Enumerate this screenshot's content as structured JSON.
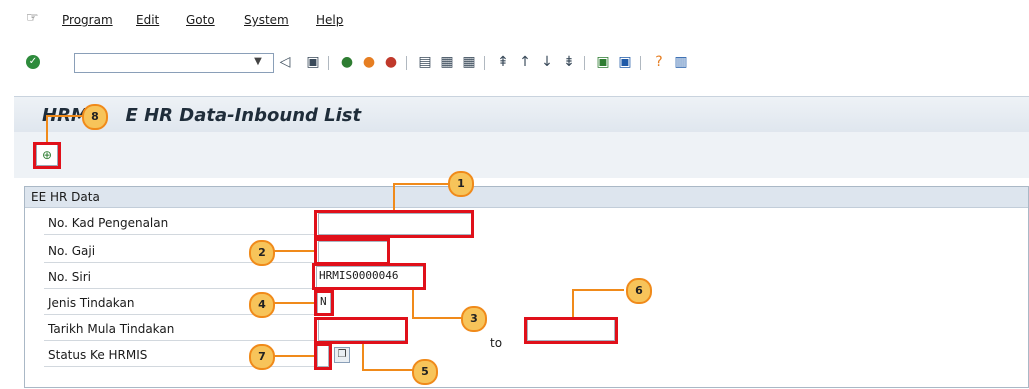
{
  "menubar": {
    "items": [
      {
        "label": "Program"
      },
      {
        "label": "Edit"
      },
      {
        "label": "Goto"
      },
      {
        "label": "System"
      },
      {
        "label": "Help"
      }
    ]
  },
  "toolbar": {
    "command_value": "",
    "icons": [
      "check-icon",
      "dropdown-icon",
      "back-icon",
      "save-icon",
      "green-arrow-icon",
      "exit-icon",
      "cancel-icon",
      "print-icon",
      "find-icon",
      "find-next-icon",
      "first-page-icon",
      "prev-page-icon",
      "next-page-icon",
      "last-page-icon",
      "new-session-icon",
      "shortcut-icon",
      "help-icon",
      "layout-icon"
    ]
  },
  "title": "HRMIS EE HR Data-Inbound List",
  "title_visible_parts": {
    "left": "HRMI",
    "right": "E HR Data-Inbound List"
  },
  "group": {
    "title": "EE HR Data",
    "fields": [
      {
        "label": "No. Kad Pengenalan",
        "value": ""
      },
      {
        "label": "No. Gaji",
        "value": ""
      },
      {
        "label": "No. Siri",
        "value": "HRMIS0000046"
      },
      {
        "label": "Jenis Tindakan",
        "value": "N"
      },
      {
        "label": "Tarikh Mula Tindakan",
        "value": ""
      },
      {
        "label": "Status Ke HRMIS",
        "value": ""
      }
    ],
    "to_label": "to",
    "to_value": ""
  },
  "callouts": [
    "1",
    "2",
    "3",
    "4",
    "5",
    "6",
    "7",
    "8"
  ],
  "colors": {
    "highlight": "#e0101a",
    "callout_fill": "#f7c45a",
    "callout_border": "#f08a1a"
  }
}
